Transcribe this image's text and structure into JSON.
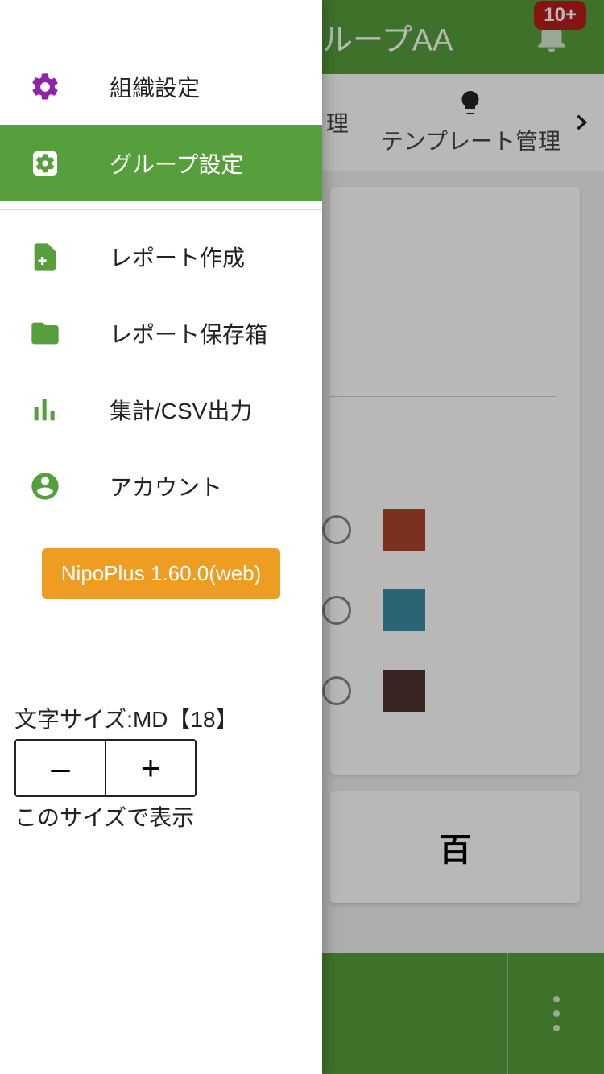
{
  "header": {
    "title_visible": "ループAA",
    "badge": "10+"
  },
  "tabs": {
    "fragment_left": "理",
    "template_mgmt": "テンプレート管理"
  },
  "card2_text": "百",
  "colors": {
    "swatch1": "#ab4429",
    "swatch2": "#3b8ba3",
    "swatch3": "#4e342e"
  },
  "drawer": {
    "items": [
      {
        "label": "組織設定",
        "key": "org-settings"
      },
      {
        "label": "グループ設定",
        "key": "group-settings"
      },
      {
        "label": "レポート作成",
        "key": "report-create"
      },
      {
        "label": "レポート保存箱",
        "key": "report-box"
      },
      {
        "label": "集計/CSV出力",
        "key": "summary-csv"
      },
      {
        "label": "アカウント",
        "key": "account"
      }
    ],
    "version": "NipoPlus 1.60.0(web)",
    "font_size_label": "文字サイズ:MD【18】",
    "font_note": "このサイズで表示",
    "minus": "–",
    "plus": "+"
  }
}
